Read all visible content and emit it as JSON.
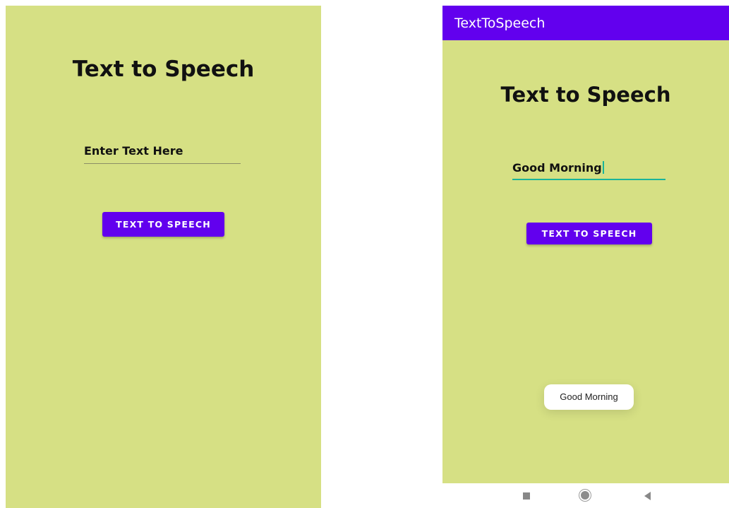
{
  "left_screen": {
    "heading": "Text to Speech",
    "text_field": {
      "value": "",
      "placeholder": "Enter Text Here"
    },
    "button_label": "TEXT TO SPEECH"
  },
  "right_screen": {
    "app_bar_title": "TextToSpeech",
    "heading": "Text to Speech",
    "text_field": {
      "value": "Good Morning"
    },
    "button_label": "TEXT TO SPEECH",
    "toast_message": "Good Morning"
  },
  "nav_bar": {
    "icons": [
      "recents-icon",
      "home-icon",
      "back-icon"
    ]
  },
  "colors": {
    "background": "#d6e084",
    "accent": "#6200ee",
    "input_underline_focused": "#19b49a"
  }
}
